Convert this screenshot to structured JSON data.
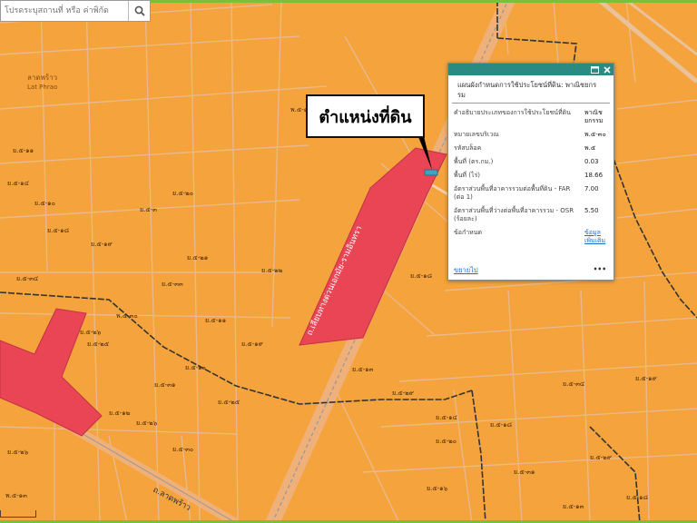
{
  "search": {
    "placeholder": "โปรดระบุสถานที่ หรือ ค่าพิกัด",
    "icon": "search-icon"
  },
  "callout": {
    "text": "ตำแหน่งที่ดิน"
  },
  "popup": {
    "title": "แผนผังกำหนดการใช้ประโยชน์ที่ดิน: พาณิชยกรรม",
    "rows": [
      {
        "key": "คำอธิบายประเภทของการใช้ประโยชน์ที่ดิน",
        "value": "พาณิชยกรรม"
      },
      {
        "key": "หมายเลขบริเวณ",
        "value": "พ.๕-๓๐"
      },
      {
        "key": "รหัสบล็อค",
        "value": "พ.๕"
      },
      {
        "key": "พื้นที่ (ตร.กม.)",
        "value": "0.03"
      },
      {
        "key": "พื้นที่ (ไร่)",
        "value": "18.66"
      },
      {
        "key": "อัตราส่วนพื้นที่อาคารรวมต่อพื้นที่ดิน - FAR (ต่อ 1)",
        "value": "7.00"
      },
      {
        "key": "อัตราส่วนพื้นที่ว่างต่อพื้นที่อาคารรวม - OSR (ร้อยละ)",
        "value": "5.50"
      },
      {
        "key": "ข้อกำหนด",
        "value": "ข้อมูลเพิ่มเติม",
        "link": true
      }
    ],
    "footer_zoom": "ขยายไป",
    "footer_more": "•••",
    "icons": [
      "maximize-icon",
      "close-icon"
    ]
  },
  "map": {
    "colors": {
      "residential": "#f5a33c",
      "commercial": "#e94555",
      "road": "#f0b77e",
      "block_line": "#e7b98a",
      "boundary": "#333333",
      "header": "#2b8a82",
      "marker": "#3aa6c2"
    },
    "place_labels": [
      {
        "id": "lat-phrao",
        "text": "ลาดพร้าว"
      },
      {
        "id": "lat-phrao-en",
        "text": "Lat Phrao"
      }
    ],
    "road_labels": [
      {
        "id": "road-ramintra",
        "text": "ถ.เลียบทางด่วนเอกมัย-รามอินทรา"
      },
      {
        "id": "road-latphrao",
        "text": "ถ.ลาดพร้าว"
      }
    ],
    "zone_labels": [
      "ย.๕-๑๑",
      "พ.๕-๑๕",
      "ย.๕-๑๔",
      "ย.๕-๒๐",
      "ย.๕-๑๐",
      "ย.๕-๓",
      "ย.๕-๑๘",
      "ย.๕-๑๙",
      "ย.๕-๒๑",
      "ย.๕-๒๒",
      "ย.๕-๓๓",
      "ย.๕-๓๔",
      "ย.๕-๑๘",
      "พ.๕-๓๐",
      "ย.๕-๒๖",
      "ย.๕-๒๕",
      "ย.๕-๑๑",
      "ย.๕-๑๙",
      "ย.๕-๑๐",
      "ย.๕-๓๑",
      "ย.๕-๑๓",
      "ย.๕-๒๕",
      "ย.๕-๑๒",
      "ย.๕-๒๖",
      "ย.๕-๓๐",
      "ย.๕-๒๙",
      "ย.๕-๑๔",
      "ย.๕-๓๔",
      "ย.๕-๑๙",
      "ย.๕-๒๐",
      "ย.๕-๒๙",
      "ย.๕-๓๑",
      "ย.๕-๑๘",
      "ย.๕-๑๓",
      "ย.๕-๑๖",
      "ย.๕-๑๘",
      "พ.๕-๑๓",
      "ย.๕-๒๖"
    ]
  }
}
